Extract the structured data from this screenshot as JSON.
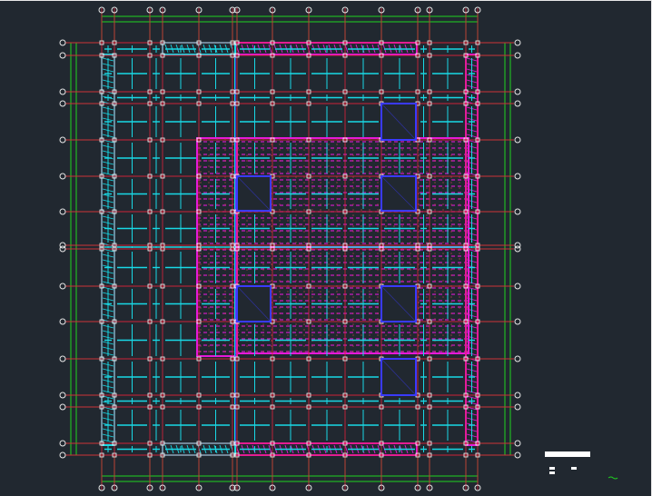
{
  "drawing": {
    "background_color": "#212830",
    "grid_line_color": "#1fd31f",
    "axis_color": "#e8e8e8",
    "beam_color": "#e0223a",
    "column_color": "#19d9e6",
    "slab_color": "#e619d9",
    "opening_color": "#3a3aff",
    "secondary_beam_color": "#d84a4a"
  },
  "legend": {
    "bar_color": "#ffffff",
    "note_color": "#1fd31f"
  }
}
